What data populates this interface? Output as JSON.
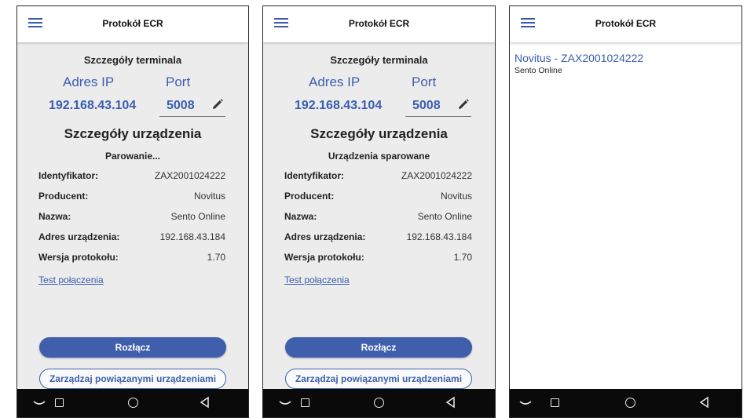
{
  "app": {
    "title": "Protokół ECR"
  },
  "terminal": {
    "section_title": "Szczegóły terminala",
    "ip_label": "Adres IP",
    "port_label": "Port",
    "ip_value": "192.168.43.104",
    "port_value": "5008"
  },
  "device": {
    "section_title": "Szczegóły urządzenia",
    "rows": [
      {
        "label": "Identyfikator:",
        "value": "ZAX2001024222"
      },
      {
        "label": "Producent:",
        "value": "Novitus"
      },
      {
        "label": "Nazwa:",
        "value": "Sento Online"
      },
      {
        "label": "Adres urządzenia:",
        "value": "192.168.43.184"
      },
      {
        "label": "Wersja protokołu:",
        "value": "1.70"
      }
    ],
    "test_link": "Test połączenia",
    "disconnect_label": "Rozłącz",
    "manage_label": "Zarządzaj powiązanymi urządzeniami"
  },
  "screens": [
    {
      "status": "Parowanie..."
    },
    {
      "status": "Urządzenia sparowane"
    }
  ],
  "device_list": [
    {
      "title": "Novitus - ZAX2001024222",
      "subtitle": "Sento Online"
    }
  ],
  "colors": {
    "accent": "#3f5fac",
    "background": "#ececec",
    "navbar": "#0a0a0a"
  },
  "icons": {
    "menu": "menu-icon",
    "edit": "pencil-icon",
    "back": "nav-back-icon",
    "recent": "nav-recent-icon",
    "home": "nav-home-icon",
    "triangle": "nav-triangle-icon"
  }
}
